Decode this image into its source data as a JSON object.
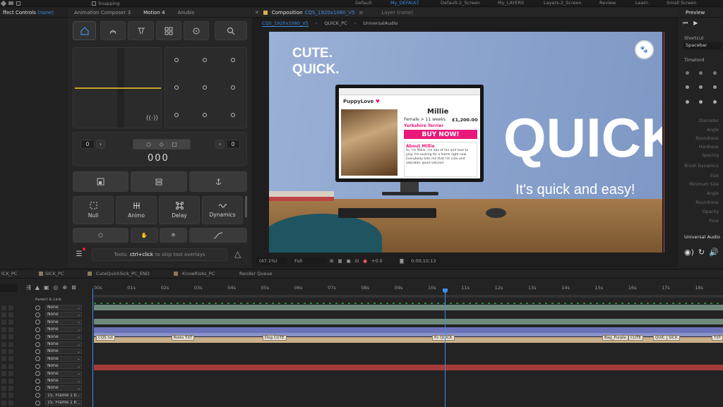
{
  "workspaces": [
    "Default",
    "My_DEFAULT",
    "Default-2_Screen",
    "My_LAYERS",
    "Layers-2_Screen",
    "Review",
    "Learn",
    "Small Screen"
  ],
  "toolbar": {
    "snapping_label": "Snapping"
  },
  "effect_controls": {
    "title": "ffect Controls",
    "value": "(none)"
  },
  "plugin_panel": {
    "tabs": [
      "Animation Composer 3",
      "Motion 4",
      "Anubis"
    ],
    "counter_left": "0",
    "counter_right": "0",
    "counter_center": "000",
    "actions": [
      "Null",
      "Animo",
      "Delay",
      "Dynamics"
    ],
    "tools_hint_prefix": "Tools: ",
    "tools_hint_key": "ctrl+click",
    "tools_hint_suffix": " to skip tool overlays"
  },
  "composition": {
    "tab_label": "Composition",
    "tab_name": "CQS_1920x1080_V5",
    "layer_label": "Layer (none)",
    "breadcrumbs": [
      "CQS_1920x1080_V5",
      "QUICK_PC",
      "UniversalAudio"
    ],
    "zoom": "(47.1%)",
    "quality": "Full",
    "exposure": "+0.0",
    "timecode": "0;00;10;13",
    "scene": {
      "headline_line1": "CUTE.",
      "headline_line2": "QUICK.",
      "big_word": "QUICK",
      "tagline": "It's quick and easy!",
      "brand": "PuppyLove",
      "puppy_name": "Millie",
      "puppy_details": "Female > 11 weeks",
      "price": "£1,200.00",
      "breed": "Yorkshire Terrier",
      "cta": "BUY NOW!",
      "about_title": "About Millie",
      "about_text": "Hi, I'm Millie, I'm lots of fun and love to play. I'm looking for a home right now. Everybody tells me that I'm cute and adorable, good natured"
    }
  },
  "preview_panel": {
    "title": "Preview",
    "shortcut_label": "Shortcut",
    "shortcut_value": "Spacebar",
    "timelord_label": "Timelord",
    "audio_label": "Universal Audio"
  },
  "brush_labels": [
    "Diameter",
    "Angle",
    "Roundness",
    "Hardness",
    "Spacing",
    "Brush Dynamics",
    "Size",
    "Minimum Size",
    "Angle",
    "Roundness",
    "Opacity",
    "Flow"
  ],
  "timeline": {
    "tabs": [
      "ICK_PC",
      "SICK_PC",
      "CuteQuickSick_PC_END",
      "KnowRisks_PC",
      "Render Queue"
    ],
    "ticks": [
      "00s",
      "01s",
      "02s",
      "03s",
      "04s",
      "05s",
      "06s",
      "07s",
      "08s",
      "09s",
      "10s",
      "11s",
      "12s",
      "13s",
      "14s",
      "15s",
      "16s",
      "17s",
      "18s"
    ],
    "parent_header": "Parent & Link",
    "layer_parents": [
      "None",
      "None",
      "None",
      "None",
      "None",
      "None",
      "None",
      "None",
      "None",
      "None",
      "None",
      "None",
      "15. Frame 1 b",
      "15. Frame 1 b"
    ],
    "markers": [
      "CQS txt",
      "Risks TXT",
      "Dog CUTE",
      "Pc QUICK",
      "Bag_Purple",
      "CUTE",
      "QUIC",
      "SICK",
      "TXT"
    ]
  },
  "colors": {
    "accent": "#3d8ee6",
    "cta": "#e8197a",
    "scene_bg": "#8ea6cf",
    "marker_bar": "#6b72b8",
    "red_bar": "#a53b3b",
    "green_bar": "#6f8a7b"
  }
}
